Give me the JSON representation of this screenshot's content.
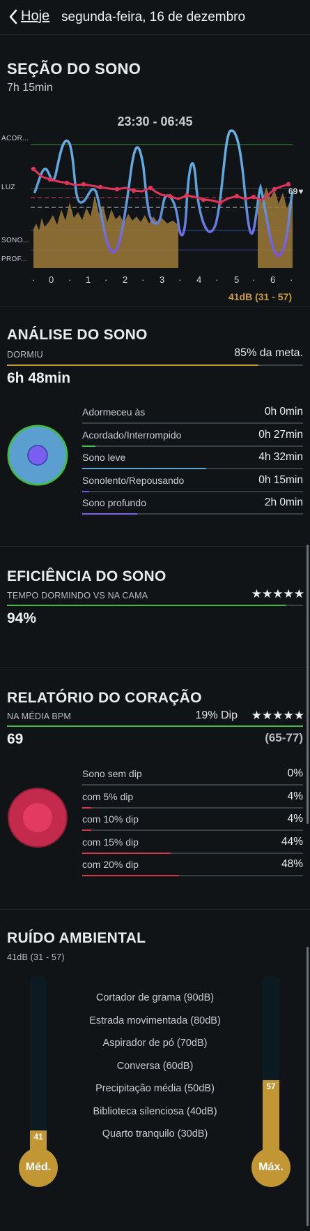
{
  "header": {
    "back_label": "Hoje",
    "date": "segunda-feira, 16 de dezembro"
  },
  "sleep_section": {
    "title": "SEÇÃO DO SONO",
    "duration": "7h 15min",
    "time_range": "23:30 - 06:45",
    "y_labels": [
      "ACOR...",
      "LUZ",
      "SONO...",
      "PROF..."
    ],
    "x_ticks": [
      "0",
      "1",
      "2",
      "3",
      "4",
      "5",
      "6"
    ],
    "heart_end_value": "69",
    "noise_summary": "41dB (31 - 57)",
    "colors": {
      "stage_line": "#5aa7d6",
      "heart_line": "#e0355a",
      "noise_area": "#a8803a"
    }
  },
  "analysis": {
    "title": "ANÁLISE DO SONO",
    "slept_label": "DORMIU",
    "goal_text": "85% da meta.",
    "goal_fraction": 0.85,
    "slept_value": "6h 48min",
    "rows": [
      {
        "label": "Adormeceu às",
        "value": "0h 0min",
        "fraction": 0,
        "color": "#4a90c8"
      },
      {
        "label": "Acordado/Interrompido",
        "value": "0h 27min",
        "fraction": 0.06,
        "color": "#3fbf4f"
      },
      {
        "label": "Sono leve",
        "value": "4h 32min",
        "fraction": 0.56,
        "color": "#5aa7d6"
      },
      {
        "label": "Sonolento/Repousando",
        "value": "0h 15min",
        "fraction": 0.03,
        "color": "#6a58e6"
      },
      {
        "label": "Sono profundo",
        "value": "2h 0min",
        "fraction": 0.25,
        "color": "#7a5ef0"
      }
    ]
  },
  "efficiency": {
    "title": "EFICIÊNCIA DO SONO",
    "subtitle": "TEMPO DORMINDO VS NA CAMA",
    "stars": "★★★★★",
    "value": "94%",
    "fraction": 0.94
  },
  "heart": {
    "title": "RELATÓRIO DO CORAÇÃO",
    "subtitle": "NA MÉDIA BPM",
    "dip_text": "19% Dip",
    "stars": "★★★★★",
    "value": "69",
    "range": "(65-77)",
    "rows": [
      {
        "label": "Sono sem dip",
        "value": "0%",
        "fraction": 0
      },
      {
        "label": "com 5% dip",
        "value": "4%",
        "fraction": 0.04
      },
      {
        "label": "com 10% dip",
        "value": "4%",
        "fraction": 0.04
      },
      {
        "label": "com 15% dip",
        "value": "44%",
        "fraction": 0.4
      },
      {
        "label": "com 20% dip",
        "value": "48%",
        "fraction": 0.44
      }
    ]
  },
  "noise": {
    "title": "RUÍDO AMBIENTAL",
    "subtitle": "41dB (31 - 57)",
    "levels": [
      "Cortador de grama (90dB)",
      "Estrada movimentada (80dB)",
      "Aspirador de pó (70dB)",
      "Conversa (60dB)",
      "Precipitação média (50dB)",
      "Biblioteca silenciosa (40dB)",
      "Quarto tranquilo (30dB)"
    ],
    "avg_label": "Méd.",
    "avg_value": "41",
    "max_label": "Máx.",
    "max_value": "57"
  }
}
